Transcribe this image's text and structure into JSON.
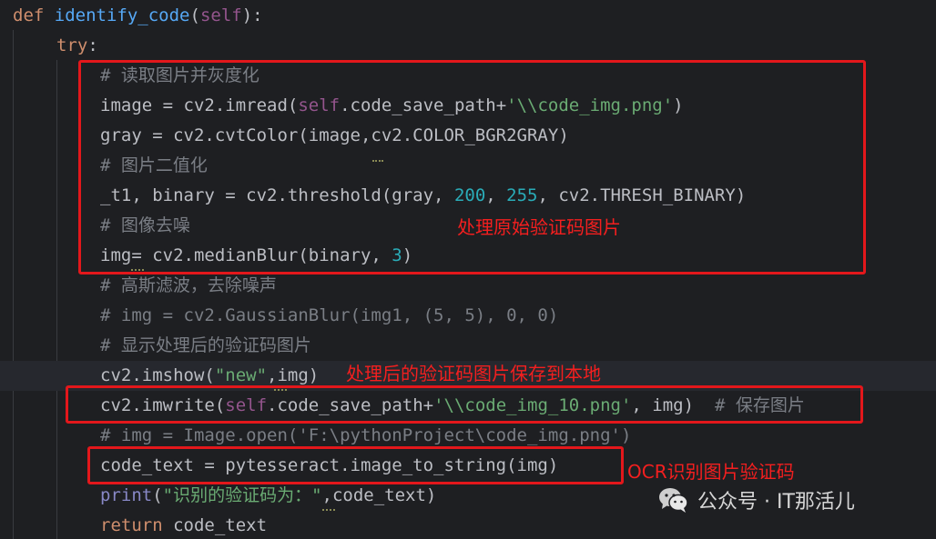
{
  "editor": {
    "lines": [
      {
        "tokens": [
          {
            "t": "def ",
            "c": "kw"
          },
          {
            "t": "identify_code",
            "c": "fn"
          },
          {
            "t": "(",
            "c": "plain"
          },
          {
            "t": "self",
            "c": "self"
          },
          {
            "t": "):",
            "c": "plain"
          }
        ]
      },
      {
        "tokens": [
          {
            "t": "try",
            "c": "kw"
          },
          {
            "t": ":",
            "c": "plain"
          }
        ]
      },
      {
        "tokens": [
          {
            "t": "# 读取图片并灰度化",
            "c": "cmt"
          }
        ]
      },
      {
        "tokens": [
          {
            "t": "image = cv2.imread(",
            "c": "plain"
          },
          {
            "t": "self",
            "c": "self"
          },
          {
            "t": ".code_save_path+",
            "c": "plain"
          },
          {
            "t": "'\\\\code_img.png'",
            "c": "str"
          },
          {
            "t": ")",
            "c": "plain"
          }
        ]
      },
      {
        "tokens": [
          {
            "t": "gray = cv2.cvtColor(image,cv2.COLOR_BGR2GRAY)",
            "c": "plain"
          }
        ]
      },
      {
        "tokens": [
          {
            "t": "# 图片二值化",
            "c": "cmt"
          }
        ]
      },
      {
        "tokens": [
          {
            "t": "_t1, binary = cv2.threshold(gray, ",
            "c": "plain"
          },
          {
            "t": "200",
            "c": "num"
          },
          {
            "t": ", ",
            "c": "plain"
          },
          {
            "t": "255",
            "c": "num"
          },
          {
            "t": ", cv2.THRESH_BINARY)",
            "c": "plain"
          }
        ]
      },
      {
        "tokens": [
          {
            "t": "# 图像去噪",
            "c": "cmt"
          }
        ]
      },
      {
        "tokens": [
          {
            "t": "img= cv2.medianBlur(binary, ",
            "c": "plain"
          },
          {
            "t": "3",
            "c": "num"
          },
          {
            "t": ")",
            "c": "plain"
          }
        ]
      },
      {
        "tokens": [
          {
            "t": "# 高斯滤波，去除噪声",
            "c": "cmt"
          }
        ]
      },
      {
        "tokens": [
          {
            "t": "# img = cv2.GaussianBlur(img1, (5, 5), 0, 0)",
            "c": "cmt"
          }
        ]
      },
      {
        "tokens": [
          {
            "t": "# 显示处理后的验证码图片",
            "c": "cmt"
          }
        ]
      },
      {
        "tokens": [
          {
            "t": "cv2.imshow(",
            "c": "plain"
          },
          {
            "t": "\"new\"",
            "c": "str"
          },
          {
            "t": ",img)",
            "c": "plain"
          }
        ]
      },
      {
        "tokens": [
          {
            "t": "cv2.imwrite(",
            "c": "plain"
          },
          {
            "t": "self",
            "c": "self"
          },
          {
            "t": ".code_save_path+",
            "c": "plain"
          },
          {
            "t": "'\\\\code_img_10.png'",
            "c": "str"
          },
          {
            "t": ", img)  ",
            "c": "plain"
          },
          {
            "t": "# 保存图片",
            "c": "cmt"
          }
        ]
      },
      {
        "tokens": [
          {
            "t": "# img = Image.open('F:\\pythonProject\\code_img.png')",
            "c": "cmt"
          }
        ]
      },
      {
        "tokens": [
          {
            "t": "code_text = pytesseract.image_to_string(img)",
            "c": "plain"
          }
        ]
      },
      {
        "tokens": [
          {
            "t": "print",
            "c": "builtin"
          },
          {
            "t": "(",
            "c": "plain"
          },
          {
            "t": "\"识别的验证码为：\"",
            "c": "str"
          },
          {
            "t": ",code_text)",
            "c": "plain"
          }
        ]
      },
      {
        "tokens": [
          {
            "t": "return ",
            "c": "kw"
          },
          {
            "t": "code_text",
            "c": "plain"
          }
        ]
      }
    ]
  },
  "annotations": {
    "a1": "处理原始验证码图片",
    "a2": "处理后的验证码图片保存到本地",
    "a3": "OCR识别图片验证码"
  },
  "watermark": {
    "text": "公众号 · IT那活儿",
    "icon": "wechat-icon"
  },
  "colors": {
    "background": "#1e1f22",
    "keyword": "#cf8e6d",
    "function": "#56a8f5",
    "self": "#94558d",
    "string": "#6aab73",
    "number": "#2aacb8",
    "comment": "#7a7e85",
    "annotation_red": "#e3171b"
  }
}
